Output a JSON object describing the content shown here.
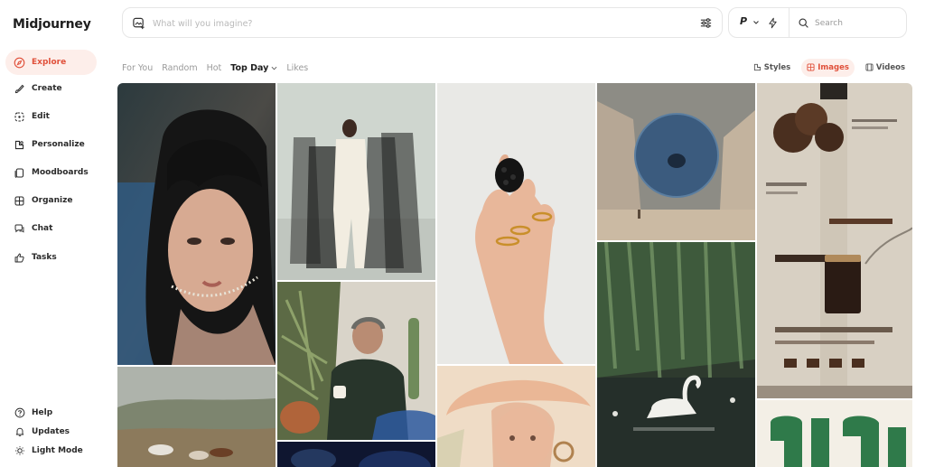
{
  "app": {
    "brand": "Midjourney"
  },
  "sidebar": {
    "items": [
      {
        "label": "Explore",
        "icon": "compass-icon",
        "active": true
      },
      {
        "label": "Create",
        "icon": "brush-icon"
      },
      {
        "label": "Edit",
        "icon": "edit-icon"
      },
      {
        "label": "Personalize",
        "icon": "personalize-icon"
      },
      {
        "label": "Moodboards",
        "icon": "moodboards-icon"
      },
      {
        "label": "Organize",
        "icon": "grid-icon"
      },
      {
        "label": "Chat",
        "icon": "chat-icon"
      },
      {
        "label": "Tasks",
        "icon": "thumbs-up-icon"
      }
    ],
    "bottom": [
      {
        "label": "Help",
        "icon": "help-icon"
      },
      {
        "label": "Updates",
        "icon": "bell-icon"
      },
      {
        "label": "Light Mode",
        "icon": "sun-icon"
      }
    ]
  },
  "prompt": {
    "placeholder": "What will you imagine?"
  },
  "mode": {
    "p_label": "P"
  },
  "search": {
    "placeholder": "Search"
  },
  "tabs": [
    {
      "label": "For You"
    },
    {
      "label": "Random"
    },
    {
      "label": "Hot"
    },
    {
      "label": "Top Day",
      "active": true
    },
    {
      "label": "Likes"
    }
  ],
  "view_toggles": [
    {
      "label": "Styles",
      "icon": "styles-icon"
    },
    {
      "label": "Images",
      "icon": "images-icon",
      "active": true
    },
    {
      "label": "Videos",
      "icon": "videos-icon"
    }
  ],
  "colors": {
    "accent": "#e0503a",
    "accent_bg": "#fdeeea"
  },
  "gallery": [
    {
      "name": "portrait-woman-image"
    },
    {
      "name": "men-white-suit-image"
    },
    {
      "name": "blackberry-hand-image"
    },
    {
      "name": "sphere-desert-image"
    },
    {
      "name": "coffee-layout-image"
    },
    {
      "name": "horses-field-image"
    },
    {
      "name": "man-plants-image"
    },
    {
      "name": "girl-hat-illustration-image"
    },
    {
      "name": "swan-lake-image"
    },
    {
      "name": "green-shapes-image"
    },
    {
      "name": "dark-blue-image"
    }
  ]
}
